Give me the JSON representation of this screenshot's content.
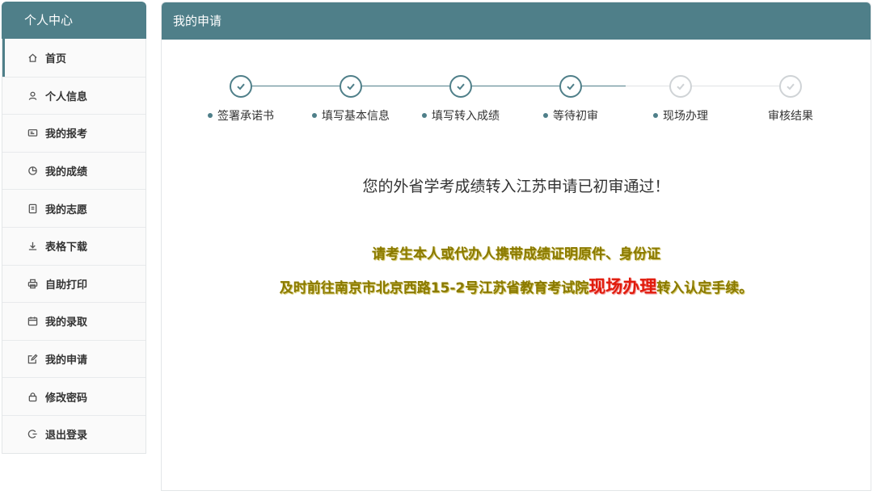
{
  "sidebar": {
    "title": "个人中心",
    "items": [
      {
        "label": "首页",
        "icon": "home-icon"
      },
      {
        "label": "个人信息",
        "icon": "user-icon"
      },
      {
        "label": "我的报考",
        "icon": "id-card-icon"
      },
      {
        "label": "我的成绩",
        "icon": "pie-chart-icon"
      },
      {
        "label": "我的志愿",
        "icon": "document-icon"
      },
      {
        "label": "表格下载",
        "icon": "download-icon"
      },
      {
        "label": "自助打印",
        "icon": "printer-icon"
      },
      {
        "label": "我的录取",
        "icon": "calendar-icon"
      },
      {
        "label": "我的申请",
        "icon": "edit-icon"
      },
      {
        "label": "修改密码",
        "icon": "lock-icon"
      },
      {
        "label": "退出登录",
        "icon": "logout-icon"
      }
    ]
  },
  "main": {
    "title": "我的申请",
    "steps": [
      {
        "label": "签署承诺书",
        "status": "done"
      },
      {
        "label": "填写基本信息",
        "status": "done"
      },
      {
        "label": "填写转入成绩",
        "status": "done"
      },
      {
        "label": "等待初审",
        "status": "done"
      },
      {
        "label": "现场办理",
        "status": "pending"
      },
      {
        "label": "审核结果",
        "status": "pending"
      }
    ],
    "message": "您的外省学考成绩转入江苏申请已初审通过！",
    "notice_line1": "请考生本人或代办人携带成绩证明原件、身份证",
    "notice_line2_pre": "及时前往南京市北京西路15-2号江苏省教育考试院",
    "notice_line2_highlight": "现场办理",
    "notice_line2_post": "转入认定手续。"
  },
  "colors": {
    "accent": "#4f7f89",
    "pending": "#cfd3d6",
    "notice": "#8a7a00",
    "highlight": "#e11b0c"
  }
}
